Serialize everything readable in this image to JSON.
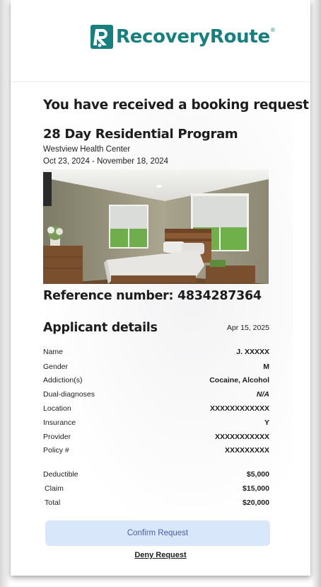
{
  "brand": {
    "name": "RecoveryRoute",
    "reg_mark": "®",
    "color": "#17807e"
  },
  "booking": {
    "heading": "You have received a booking request",
    "program": "28 Day Residential Program",
    "center": "Westview Health Center",
    "dates": "Oct 23, 2024 - November 18, 2024",
    "reference": "Reference number: 4834287364"
  },
  "applicant": {
    "heading": "Applicant details",
    "date": "Apr 15, 2025",
    "fields": [
      {
        "label": "Name",
        "value": "J. XXXXX"
      },
      {
        "label": "Gender",
        "value": "M"
      },
      {
        "label": "Addiction(s)",
        "value": "Cocaine, Alcohol"
      },
      {
        "label": "Dual-diagnoses",
        "value": "N/A"
      },
      {
        "label": "Location",
        "value": "XXXXXXXXXXXX"
      },
      {
        "label": "Insurance",
        "value": "Y"
      },
      {
        "label": "Provider",
        "value": "XXXXXXXXXXX"
      },
      {
        "label": "Policy #",
        "value": "XXXXXXXXX"
      }
    ],
    "costs": [
      {
        "label": "Deductible",
        "value": "$5,000"
      },
      {
        "label": "Claim",
        "value": "$15,000"
      },
      {
        "label": "Total",
        "value": "$20,000"
      }
    ]
  },
  "actions": {
    "confirm_label": "Confirm Request",
    "deny_label": "Deny Request",
    "confirm_bg": "#d9e7fb",
    "confirm_text_color": "#4a5ea8"
  }
}
